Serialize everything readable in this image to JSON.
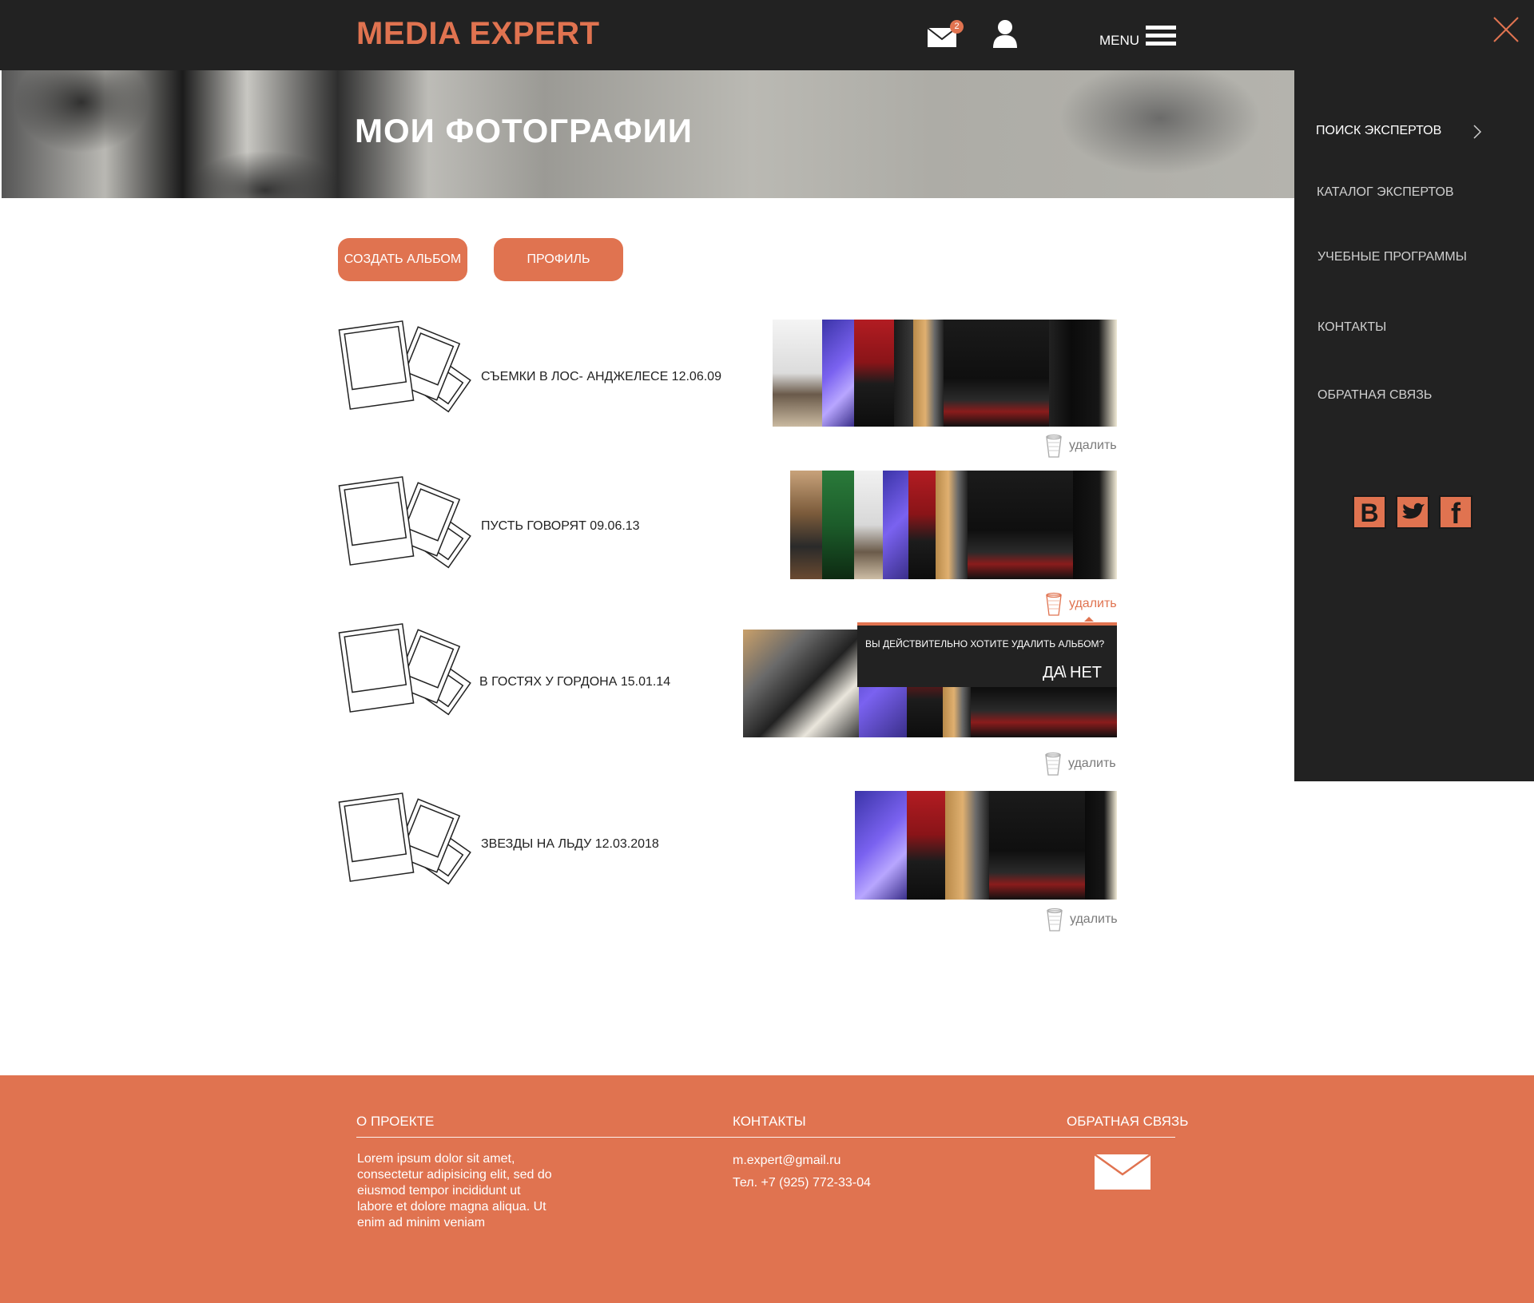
{
  "header": {
    "logo": "MEDIA EXPERT",
    "mail_count": "2",
    "menu_label": "MENU",
    "accent_color": "#e07350",
    "bar_color": "#222222"
  },
  "banner": {
    "title": "МОИ ФОТОГРАФИИ"
  },
  "actions": {
    "create_album": "СОЗДАТЬ АЛЬБОМ",
    "profile": "ПРОФИЛЬ"
  },
  "albums": [
    {
      "title": "СЪЕМКИ  В ЛОС- АНДЖЕЛЕСЕ 12.06.09",
      "delete_label": "удалить"
    },
    {
      "title": "ПУСТЬ ГОВОРЯТ 09.06.13",
      "delete_label": "удалить"
    },
    {
      "title": "В ГОСТЯХ У ГОРДОНА 15.01.14",
      "delete_label": "удалить"
    },
    {
      "title": "ЗВЕЗДЫ НА ЛЬДУ 12.03.2018",
      "delete_label": "удалить"
    }
  ],
  "confirm_dialog": {
    "question": "ВЫ ДЕЙСТВИТЕЛЬНО ХОТИТЕ УДАЛИТЬ АЛЬБОМ?",
    "yes": "ДА",
    "separator": "\\",
    "no": "НЕТ"
  },
  "side_menu": {
    "items": [
      {
        "label": "ПОИСК ЭКСПЕРТОВ"
      },
      {
        "label": "КАТАЛОГ ЭКСПЕРТОВ"
      },
      {
        "label": "УЧЕБНЫЕ ПРОГРАММЫ"
      },
      {
        "label": "КОНТАКТЫ"
      },
      {
        "label": "ОБРАТНАЯ СВЯЗЬ"
      }
    ],
    "social": [
      {
        "glyph": "B",
        "icon": "vk-icon"
      },
      {
        "glyph": "",
        "icon": "twitter-icon"
      },
      {
        "glyph": "f",
        "icon": "facebook-icon"
      }
    ]
  },
  "footer": {
    "about_heading": "О ПРОЕКТЕ",
    "about_text": "Lorem ipsum dolor sit amet,\nconsectetur adipisicing elit, sed do\neiusmod tempor incididunt ut\nlabore et dolore magna aliqua. Ut\nenim ad minim veniam",
    "contacts_heading": "КОНТАКТЫ",
    "email": "m.expert@gmail.ru",
    "phone": "Тел.  +7 (925) 772-33-04",
    "feedback_heading": "ОБРАТНАЯ СВЯЗЬ"
  }
}
